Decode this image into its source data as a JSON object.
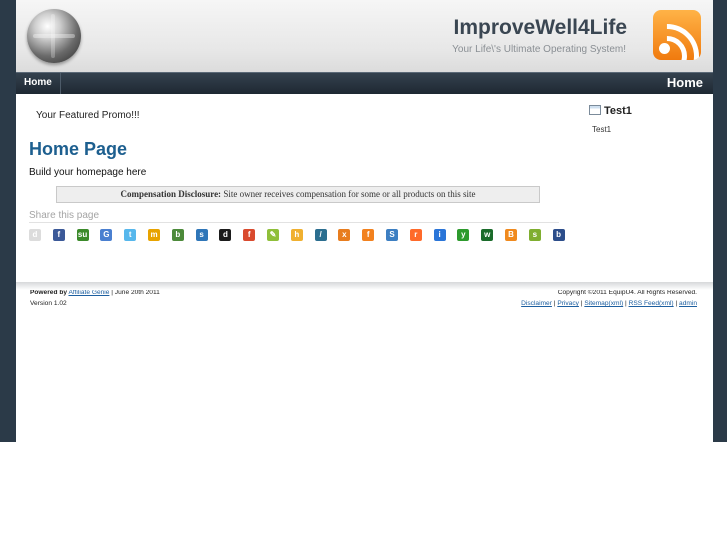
{
  "header": {
    "site_title": "ImproveWell4Life",
    "tagline": "Your Life\\'s Ultimate Operating System!"
  },
  "nav": {
    "home_label": "Home",
    "page_title": "Home"
  },
  "main": {
    "promo": "Your Featured Promo!!!",
    "heading": "Home Page",
    "body": "Build your homepage here",
    "disclosure_label": "Compensation Disclosure:",
    "disclosure_text": " Site owner receives compensation for some or all products on this site",
    "share_label": "Share this page"
  },
  "share_icons": [
    {
      "name": "digg-icon",
      "glyph": "d",
      "color": "#dcdcdc"
    },
    {
      "name": "facebook-icon",
      "glyph": "f",
      "color": "#3b5998"
    },
    {
      "name": "stumbleupon-icon",
      "glyph": "su",
      "color": "#3b8a2a"
    },
    {
      "name": "google-icon",
      "glyph": "G",
      "color": "#4a7fd0"
    },
    {
      "name": "twitter-icon",
      "glyph": "t",
      "color": "#56b7ec"
    },
    {
      "name": "myspace-icon",
      "glyph": "m",
      "color": "#e8a300"
    },
    {
      "name": "bookmark-icon",
      "glyph": "b",
      "color": "#4c8a3a"
    },
    {
      "name": "spurl-icon",
      "glyph": "s",
      "color": "#2f76b8"
    },
    {
      "name": "delicious-icon",
      "glyph": "d",
      "color": "#1c1c1c"
    },
    {
      "name": "furl-icon",
      "glyph": "f",
      "color": "#d94a2e"
    },
    {
      "name": "fark-icon",
      "glyph": "✎",
      "color": "#8fbf3a"
    },
    {
      "name": "hugg-icon",
      "glyph": "h",
      "color": "#f0b030"
    },
    {
      "name": "linkagogo-icon",
      "glyph": "/",
      "color": "#2b6e8f"
    },
    {
      "name": "mixx-icon",
      "glyph": "x",
      "color": "#e87d1e"
    },
    {
      "name": "blinklist-icon",
      "glyph": "f",
      "color": "#f2811e"
    },
    {
      "name": "stumble-icon",
      "glyph": "S",
      "color": "#3d7fc2"
    },
    {
      "name": "reddit-icon",
      "glyph": "r",
      "color": "#ff6a2a"
    },
    {
      "name": "netvouz-icon",
      "glyph": "i",
      "color": "#2a75d8"
    },
    {
      "name": "yahoo-icon",
      "glyph": "y",
      "color": "#2d9a2d"
    },
    {
      "name": "wink-icon",
      "glyph": "w",
      "color": "#1a6b2a"
    },
    {
      "name": "blogmarks-icon",
      "glyph": "B",
      "color": "#f08a1e"
    },
    {
      "name": "simpy-icon",
      "glyph": "s",
      "color": "#7fae30"
    },
    {
      "name": "backflip-icon",
      "glyph": "b",
      "color": "#2c4d8a"
    }
  ],
  "sidebar": {
    "widget_title": "Test1",
    "widget_text": "Test1"
  },
  "footer": {
    "powered_prefix": "Powered by",
    "powered_link": "Affiliate Genie",
    "powered_date": "| June 20th 2011",
    "version": "Version 1.02",
    "copyright": "Copyright ©2011 EquipU4. All Rights Reserved.",
    "links": [
      "Disclaimer",
      "Privacy",
      "Sitemap(xml)",
      "RSS Feed(xml)",
      "admin"
    ]
  },
  "colors": {
    "frame": "#2b3a48",
    "heading": "#1d5f8f",
    "rss": "#f07a0e"
  }
}
